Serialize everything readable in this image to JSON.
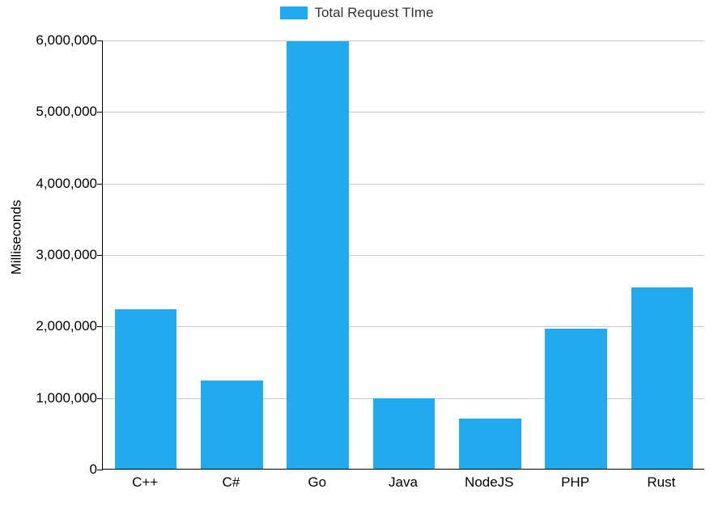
{
  "legend": {
    "label": "Total Request TIme"
  },
  "axes": {
    "ylabel": "Milliseconds",
    "ytick_labels": [
      "0",
      "1,000,000",
      "2,000,000",
      "3,000,000",
      "4,000,000",
      "5,000,000",
      "6,000,000"
    ]
  },
  "colors": {
    "bar": "#22aaee"
  },
  "chart_data": {
    "type": "bar",
    "title": "",
    "xlabel": "",
    "ylabel": "Milliseconds",
    "ylim": [
      0,
      6000000
    ],
    "categories": [
      "C++",
      "C#",
      "Go",
      "Java",
      "NodeJS",
      "PHP",
      "Rust"
    ],
    "series": [
      {
        "name": "Total Request TIme",
        "values": [
          2230000,
          1230000,
          5980000,
          990000,
          700000,
          1960000,
          2540000
        ]
      }
    ],
    "legend_position": "top"
  }
}
